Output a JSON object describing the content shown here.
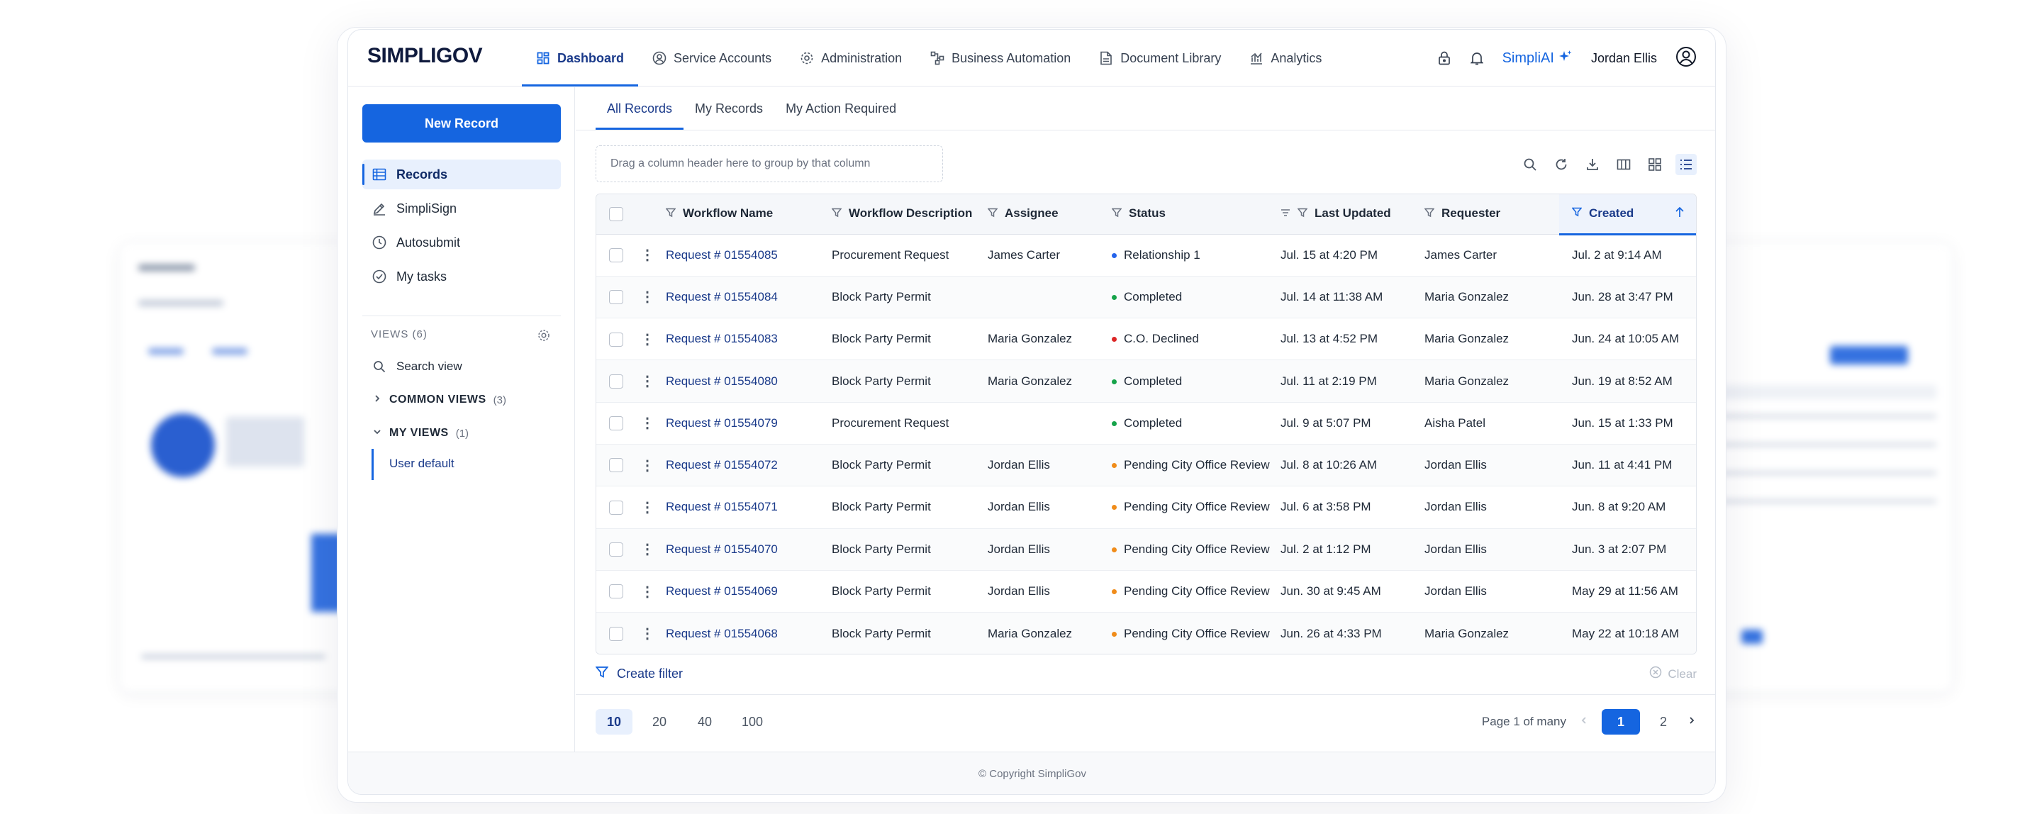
{
  "app": {
    "logo": "SIMPLIGOV"
  },
  "nav": [
    {
      "label": "Dashboard",
      "icon": "dashboard-icon",
      "active": true
    },
    {
      "label": "Service Accounts",
      "icon": "user-circle-icon"
    },
    {
      "label": "Administration",
      "icon": "gear-icon"
    },
    {
      "label": "Business Automation",
      "icon": "flow-icon"
    },
    {
      "label": "Document Library",
      "icon": "document-icon"
    },
    {
      "label": "Analytics",
      "icon": "chart-icon"
    }
  ],
  "topright": {
    "simpliai": "SimpliAI",
    "user": "Jordan Ellis"
  },
  "sidebar": {
    "new_record": "New Record",
    "items": [
      {
        "label": "Records",
        "icon": "records-icon",
        "active": true
      },
      {
        "label": "SimpliSign",
        "icon": "pen-icon"
      },
      {
        "label": "Autosubmit",
        "icon": "clock-icon"
      },
      {
        "label": "My tasks",
        "icon": "check-circle-icon"
      }
    ],
    "views_label": "VIEWS",
    "views_count": "(6)",
    "search_view": "Search view",
    "common_views": "COMMON VIEWS",
    "common_count": "(3)",
    "my_views": "MY VIEWS",
    "my_count": "(1)",
    "user_default": "User default"
  },
  "tabs": [
    "All Records",
    "My Records",
    "My Action Required"
  ],
  "group_placeholder": "Drag a column header here to group by that column",
  "columns": [
    "Workflow Name",
    "Workflow Description",
    "Assignee",
    "Status",
    "Last Updated",
    "Requester",
    "Created"
  ],
  "status_colors": {
    "blue": "#2563eb",
    "green": "#16a34a",
    "red": "#dc2626",
    "orange": "#f08c1a"
  },
  "rows": [
    {
      "name": "Request # 01554085",
      "desc": "Procurement Request",
      "assignee": "James Carter",
      "status": "Relationship 1",
      "status_color": "#2563eb",
      "updated": "Jul. 15 at 4:20 PM",
      "requester": "James Carter",
      "created": "Jul. 2 at 9:14 AM"
    },
    {
      "name": "Request # 01554084",
      "desc": "Block Party Permit",
      "assignee": "",
      "status": "Completed",
      "status_color": "#16a34a",
      "updated": "Jul. 14 at 11:38 AM",
      "requester": "Maria Gonzalez",
      "created": "Jun. 28 at 3:47 PM"
    },
    {
      "name": "Request # 01554083",
      "desc": "Block Party Permit",
      "assignee": "Maria Gonzalez",
      "status": "C.O. Declined",
      "status_color": "#dc2626",
      "updated": "Jul. 13 at 4:52 PM",
      "requester": "Maria Gonzalez",
      "created": "Jun. 24 at 10:05 AM"
    },
    {
      "name": "Request # 01554080",
      "desc": "Block Party Permit",
      "assignee": "Maria Gonzalez",
      "status": "Completed",
      "status_color": "#16a34a",
      "updated": "Jul. 11 at 2:19 PM",
      "requester": "Maria Gonzalez",
      "created": "Jun. 19 at 8:52 AM"
    },
    {
      "name": "Request # 01554079",
      "desc": "Procurement Request",
      "assignee": "",
      "status": "Completed",
      "status_color": "#16a34a",
      "updated": "Jul. 9 at 5:07 PM",
      "requester": "Aisha Patel",
      "created": "Jun. 15 at 1:33 PM"
    },
    {
      "name": "Request # 01554072",
      "desc": "Block Party Permit",
      "assignee": "Jordan Ellis",
      "status": "Pending City Office Review",
      "status_color": "#f08c1a",
      "updated": "Jul. 8 at 10:26 AM",
      "requester": "Jordan Ellis",
      "created": "Jun. 11 at 4:41 PM"
    },
    {
      "name": "Request # 01554071",
      "desc": "Block Party Permit",
      "assignee": "Jordan Ellis",
      "status": "Pending City Office Review",
      "status_color": "#f08c1a",
      "updated": "Jul. 6 at 3:58 PM",
      "requester": "Jordan Ellis",
      "created": "Jun. 8 at 9:20 AM"
    },
    {
      "name": "Request # 01554070",
      "desc": "Block Party Permit",
      "assignee": "Jordan Ellis",
      "status": "Pending City Office Review",
      "status_color": "#f08c1a",
      "updated": "Jul. 2 at 1:12 PM",
      "requester": "Jordan Ellis",
      "created": "Jun. 3 at 2:07 PM"
    },
    {
      "name": "Request # 01554069",
      "desc": "Block Party Permit",
      "assignee": "Jordan Ellis",
      "status": "Pending City Office Review",
      "status_color": "#f08c1a",
      "updated": "Jun. 30 at 9:45 AM",
      "requester": "Jordan Ellis",
      "created": "May 29 at 11:56 AM"
    },
    {
      "name": "Request # 01554068",
      "desc": "Block Party Permit",
      "assignee": "Maria Gonzalez",
      "status": "Pending City Office Review",
      "status_color": "#f08c1a",
      "updated": "Jun. 26 at 4:33 PM",
      "requester": "Maria Gonzalez",
      "created": "May 22 at 10:18 AM"
    }
  ],
  "create_filter": "Create filter",
  "clear": "Clear",
  "page_sizes": [
    "10",
    "20",
    "40",
    "100"
  ],
  "page_info": "Page 1 of many",
  "pages": [
    "1",
    "2"
  ],
  "footer": "© Copyright SimpliGov"
}
